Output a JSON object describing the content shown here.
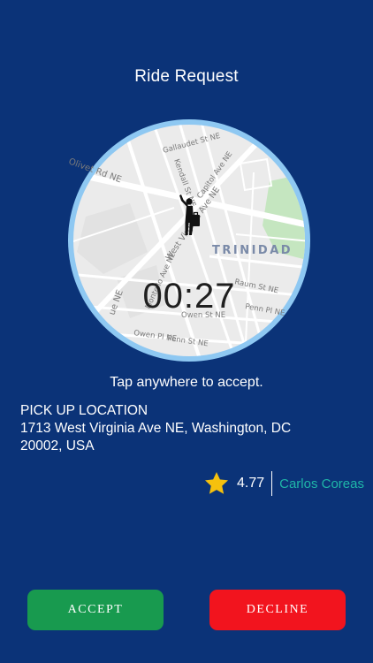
{
  "screen": {
    "title": "Ride Request",
    "timer": "00:27",
    "tap_hint": "Tap anywhere to accept."
  },
  "map": {
    "area_label": "TRINIDAD",
    "street_labels": [
      "Gallaudet St NE",
      "Kendall St NE",
      "Capitol Ave NE",
      "Olivet Rd NE",
      "West Virginia Ave NE",
      "Raum St NE",
      "Penn Pl NE",
      "Montello Ave NE",
      "Owen St NE",
      "Owen Pl NE",
      "Penn St NE",
      "ue NE"
    ],
    "colors": {
      "ring": "#8ec8f2",
      "land": "#ebebeb",
      "road": "#ffffff",
      "park": "#c5e6c0",
      "label": "#7b7b7b",
      "area_label": "#7a8aa8"
    },
    "marker_icon": "hitchhiker-with-luggage-icon"
  },
  "pickup": {
    "label": "PICK UP LOCATION",
    "address_line1": "1713 West Virginia Ave NE, Washington, DC",
    "address_line2": "20002, USA"
  },
  "rider": {
    "star_icon": "star-icon",
    "rating": "4.77",
    "name": "Carlos Coreas",
    "name_color": "#1fb6a8",
    "star_color": "#f6c10d"
  },
  "actions": {
    "accept_label": "ACCEPT",
    "decline_label": "DECLINE",
    "accept_color": "#189a4f",
    "decline_color": "#f2141e"
  }
}
